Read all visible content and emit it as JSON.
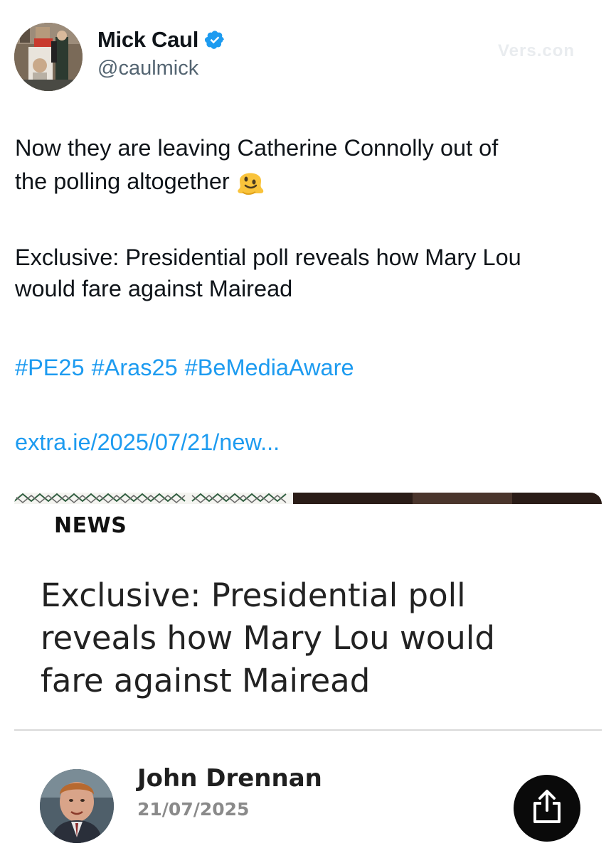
{
  "tweet": {
    "display_name": "Mick Caul",
    "handle": "@caulmick",
    "verified": true,
    "faded_watermark": "Vers.con",
    "line1": "Now they are leaving Catherine Connolly out of",
    "line2": "the polling altogether",
    "line2_emoji": "melting-face-emoji",
    "line3": "Exclusive: Presidential poll reveals how Mary Lou",
    "line4": "would fare against Mairead",
    "hashtags": [
      "#PE25",
      "#Aras25",
      "#BeMediaAware"
    ],
    "link": "extra.ie/2025/07/21/new..."
  },
  "card": {
    "category": "NEWS",
    "headline_line1": "Exclusive: Presidential poll",
    "headline_line2": "reveals how Mary Lou would",
    "headline_line3": "fare against Mairead",
    "author_name": "John Drennan",
    "date": "21/07/2025",
    "share_icon": "share-icon"
  },
  "colors": {
    "link": "#1d9bf0",
    "verified": "#1d9bf0",
    "handle": "#536471",
    "share_button": "#0a0a0a"
  }
}
